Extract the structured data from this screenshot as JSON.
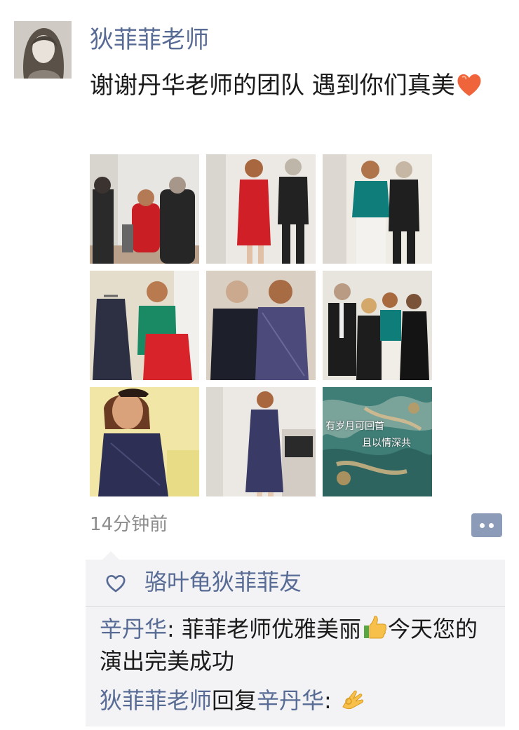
{
  "post": {
    "author": "狄菲菲老师",
    "text": "谢谢丹华老师的团队 遇到你们真美",
    "text_emoji": "heart-emoji",
    "timestamp": "14分钟前",
    "photo_count": 9,
    "photo_9_caption_line1": "有岁月可回首",
    "photo_9_caption_line2": "且以情深共"
  },
  "likes": {
    "icon": "heart-outline-icon",
    "names": "骆叶龟狄菲菲友"
  },
  "comments": [
    {
      "author": "辛丹华",
      "separator": ": ",
      "text_before_emoji": "菲菲老师优雅美丽",
      "emoji": "thumbs-up-emoji",
      "text_after_emoji": "今天您的演出完美成功"
    },
    {
      "author": "狄菲菲老师",
      "reply_word": "回复",
      "reply_to": "辛丹华",
      "separator": ": ",
      "emoji": "ok-hand-emoji"
    }
  ],
  "colors": {
    "link": "#576b95",
    "text": "#1a1a1a",
    "muted": "#8c8c8c",
    "comment_bg": "#f3f3f5",
    "action_button": "#8c9bb8"
  }
}
